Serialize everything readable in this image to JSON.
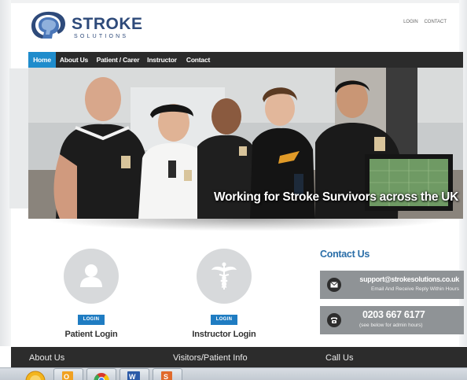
{
  "header": {
    "logo_word": "STROKE",
    "logo_sub": "SOLUTIONS",
    "top_links": [
      "LOGIN",
      "CONTACT"
    ]
  },
  "nav": {
    "items": [
      {
        "label": "Home",
        "active": true
      },
      {
        "label": "About Us",
        "active": false
      },
      {
        "label": "Patient / Carer",
        "active": false
      },
      {
        "label": "Instructor",
        "active": false
      },
      {
        "label": "Contact",
        "active": false
      }
    ]
  },
  "hero": {
    "caption": "Working for Stroke Survivors across the UK"
  },
  "logins": {
    "patient": {
      "button": "LOGIN",
      "label": "Patient Login"
    },
    "instructor": {
      "button": "LOGIN",
      "label": "Instructor Login"
    }
  },
  "contact": {
    "title": "Contact Us",
    "email": "support@strokesolutions.co.uk",
    "email_sub": "Email And Receive Reply Within Hours",
    "phone": "0203 667 6177",
    "phone_sub": "(see below for admin hours)"
  },
  "footer": {
    "items": [
      "About Us",
      "Visitors/Patient Info",
      "Call Us"
    ]
  },
  "taskbar": {
    "apps": [
      "start-orb",
      "outlook",
      "chrome",
      "word",
      "powerpoint"
    ]
  },
  "colors": {
    "brand": "#2e4a7a",
    "accent": "#1f8ccc",
    "contact_title": "#2a6ea8",
    "nav_bg": "#2b2b2b"
  }
}
